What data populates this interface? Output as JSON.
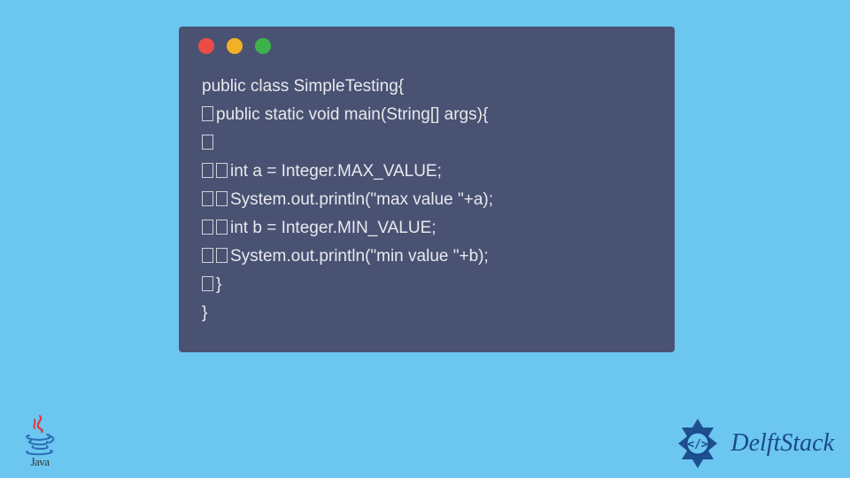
{
  "window": {
    "dots": {
      "red": "#e94b47",
      "yellow": "#f2b125",
      "green": "#3db24a"
    }
  },
  "code": {
    "lines": [
      {
        "indent": 0,
        "text": "public class SimpleTesting{"
      },
      {
        "indent": 1,
        "text": "public static void main(String[] args){"
      },
      {
        "indent": 1,
        "text": ""
      },
      {
        "indent": 2,
        "text": "int a = Integer.MAX_VALUE;"
      },
      {
        "indent": 2,
        "text": "System.out.println(\"max value \"+a);"
      },
      {
        "indent": 2,
        "text": "int b = Integer.MIN_VALUE;"
      },
      {
        "indent": 2,
        "text": "System.out.println(\"min value \"+b);"
      },
      {
        "indent": 1,
        "text": "}"
      },
      {
        "indent": 0,
        "text": "}"
      }
    ]
  },
  "footer": {
    "java_label": "Java",
    "brand": "DelftStack"
  }
}
